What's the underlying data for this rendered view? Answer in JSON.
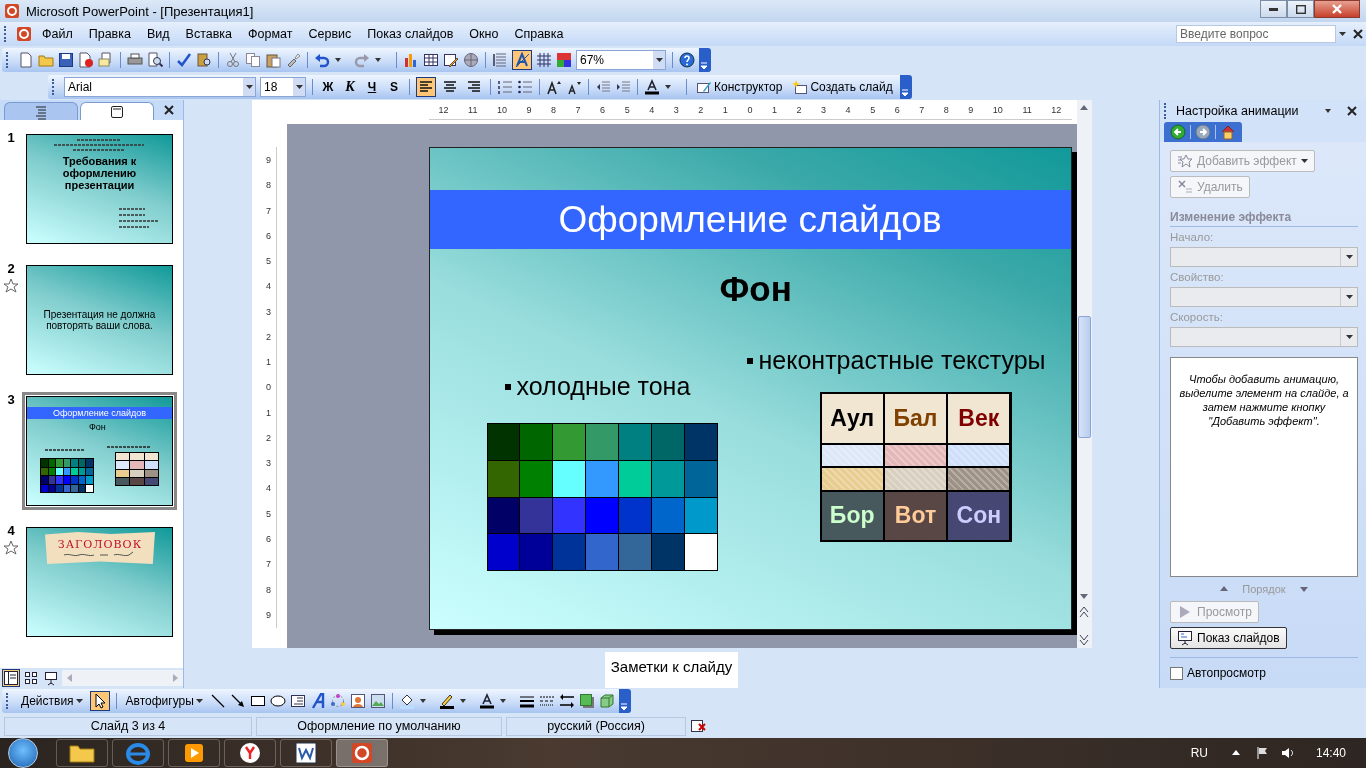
{
  "window": {
    "title": "Microsoft PowerPoint - [Презентация1]"
  },
  "menu": [
    "Файл",
    "Правка",
    "Вид",
    "Вставка",
    "Формат",
    "Сервис",
    "Показ слайдов",
    "Окно",
    "Справка"
  ],
  "help_search": {
    "placeholder": "Введите вопрос"
  },
  "standard_toolbar": {
    "show_formatting": {
      "on": true
    },
    "zoom": "67%"
  },
  "formatting_toolbar": {
    "font": "Arial",
    "size": "18",
    "style_buttons": [
      "Ж",
      "К",
      "Ч",
      "S"
    ],
    "align_buttons": [
      {
        "selected": true
      },
      {
        "selected": false
      },
      {
        "selected": false
      }
    ],
    "design_button": "Конструктор",
    "new_slide_button": "Создать слайд"
  },
  "left_panel": {
    "tabs": [
      {
        "selected": false
      },
      {
        "selected": true
      }
    ]
  },
  "slides": [
    {
      "number": "1",
      "animated": false,
      "selected": false,
      "kind": "title",
      "title": "Требования к оформлению презентации"
    },
    {
      "number": "2",
      "animated": true,
      "selected": false,
      "kind": "text",
      "text": "Презентация не должна повторять ваши слова."
    },
    {
      "number": "3",
      "animated": false,
      "selected": true,
      "kind": "layout",
      "title": "Оформление слайдов",
      "heading": "Фон"
    },
    {
      "number": "4",
      "animated": true,
      "selected": false,
      "kind": "banner",
      "banner": "ЗАГОЛОВОК"
    }
  ],
  "view_buttons": [
    {
      "selected": true
    },
    {
      "selected": false
    },
    {
      "selected": false
    }
  ],
  "ruler": {
    "horizontal": [
      "12",
      "11",
      "10",
      "9",
      "8",
      "7",
      "6",
      "5",
      "4",
      "3",
      "2",
      "1",
      "0",
      "1",
      "2",
      "3",
      "4",
      "5",
      "6",
      "7",
      "8",
      "9",
      "10",
      "11",
      "12"
    ],
    "vertical": [
      "9",
      "8",
      "7",
      "6",
      "5",
      "4",
      "3",
      "2",
      "1",
      "0",
      "1",
      "2",
      "3",
      "4",
      "5",
      "6",
      "7",
      "8",
      "9"
    ]
  },
  "slide": {
    "title": "Оформление слайдов",
    "heading": "Фон",
    "bullets": [
      "холодные тона",
      "неконтрастные текстуры"
    ],
    "swatches": [
      {
        "color": "#003300"
      },
      {
        "color": "#006600"
      },
      {
        "color": "#339933"
      },
      {
        "color": "#339966"
      },
      {
        "color": "#008080"
      },
      {
        "color": "#006666"
      },
      {
        "color": "#003366"
      },
      {
        "color": "#336600"
      },
      {
        "color": "#008000"
      },
      {
        "color": "#66ffff"
      },
      {
        "color": "#3399ff"
      },
      {
        "color": "#00cc99"
      },
      {
        "color": "#009999"
      },
      {
        "color": "#006699"
      },
      {
        "color": "#000066"
      },
      {
        "color": "#333399"
      },
      {
        "color": "#3333ff"
      },
      {
        "color": "#0000ff"
      },
      {
        "color": "#0033cc"
      },
      {
        "color": "#0066cc"
      },
      {
        "color": "#0099cc"
      },
      {
        "color": "#0000cc"
      },
      {
        "color": "#000099"
      },
      {
        "color": "#003399"
      },
      {
        "color": "#3366cc"
      },
      {
        "color": "#336699"
      },
      {
        "color": "#003366"
      },
      {
        "color": "#ffffff"
      }
    ],
    "textures": [
      {
        "kind": "label",
        "text": "Аул",
        "color": "#000000"
      },
      {
        "kind": "label",
        "text": "Бал",
        "color": "#804000"
      },
      {
        "kind": "label",
        "text": "Век",
        "color": "#800000"
      },
      {
        "kind": "texture",
        "color": "#dce7f7"
      },
      {
        "kind": "texture",
        "color": "#e4b8b8"
      },
      {
        "kind": "texture",
        "color": "#cfdffa"
      },
      {
        "kind": "texture",
        "color": "#e8cc90"
      },
      {
        "kind": "texture",
        "color": "#d8cfc0"
      },
      {
        "kind": "texture",
        "color": "#9e9286"
      },
      {
        "kind": "label",
        "text": "Бор",
        "color": "#ccffcc"
      },
      {
        "kind": "label",
        "text": "Вот",
        "color": "#ffcc99"
      },
      {
        "kind": "label",
        "text": "Сон",
        "color": "#ccccff"
      }
    ]
  },
  "notes": {
    "placeholder": "Заметки к слайду"
  },
  "task_pane": {
    "title": "Настройка анимации",
    "add_effect": {
      "label": "Добавить эффект",
      "disabled": true
    },
    "remove": {
      "label": "Удалить",
      "disabled": true
    },
    "section": "Изменение эффекта",
    "fields": [
      {
        "label": "Начало:",
        "disabled": true
      },
      {
        "label": "Свойство:",
        "disabled": true
      },
      {
        "label": "Скорость:",
        "disabled": true
      }
    ],
    "hint": "Чтобы добавить анимацию, выделите элемент на слайде, а затем нажмите кнопку \"Добавить эффект\".",
    "order": "Порядок",
    "preview": {
      "label": "Просмотр",
      "disabled": true
    },
    "slideshow": "Показ слайдов",
    "autopreview": {
      "label": "Автопросмотр",
      "checked": false
    }
  },
  "drawing_toolbar": {
    "actions": "Действия",
    "select_tool": {
      "on": true
    },
    "autoshapes": "Автофигуры"
  },
  "status_bar": [
    "Слайд 3 из 4",
    "Оформление по умолчанию",
    "русский (Россия)"
  ],
  "taskbar": {
    "apps": [
      {
        "selected": false
      },
      {
        "selected": false
      },
      {
        "selected": false
      },
      {
        "selected": false
      },
      {
        "selected": false
      },
      {
        "selected": true
      }
    ],
    "language": "RU",
    "time": "14:40"
  }
}
